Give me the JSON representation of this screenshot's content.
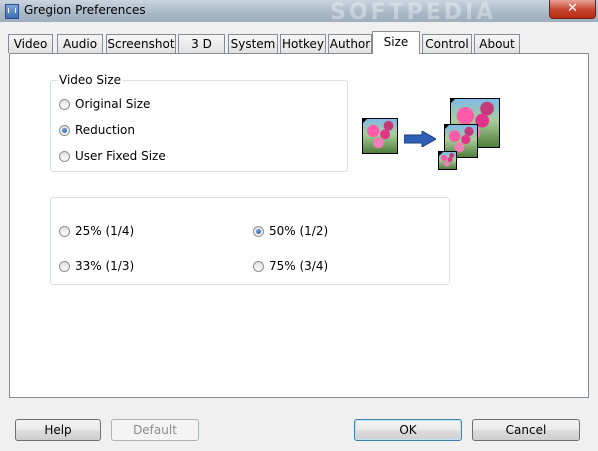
{
  "window": {
    "title": "Gregion Preferences",
    "watermark": "SOFTPEDIA",
    "close_glyph": "✕"
  },
  "tabs": [
    {
      "label": "Video"
    },
    {
      "label": "Audio"
    },
    {
      "label": "Screenshot"
    },
    {
      "label": "3 D"
    },
    {
      "label": "System"
    },
    {
      "label": "Hotkey"
    },
    {
      "label": "Author"
    },
    {
      "label": "Size",
      "active": true
    },
    {
      "label": "Control"
    },
    {
      "label": "About"
    }
  ],
  "video_size": {
    "legend": "Video Size",
    "options": [
      {
        "label": "Original Size",
        "selected": false
      },
      {
        "label": "Reduction",
        "selected": true
      },
      {
        "label": "User Fixed Size",
        "selected": false
      }
    ]
  },
  "reduction": {
    "options": [
      {
        "label": "25% (1/4)",
        "selected": false
      },
      {
        "label": "50% (1/2)",
        "selected": true
      },
      {
        "label": "33% (1/3)",
        "selected": false
      },
      {
        "label": "75% (3/4)",
        "selected": false
      }
    ]
  },
  "illustration": {
    "arrow_color": "#2f5fb7",
    "icons": [
      "flower-thumbnail-icon",
      "right-arrow-icon",
      "resized-thumbnails-icon"
    ]
  },
  "buttons": {
    "help": "Help",
    "default": "Default",
    "ok": "OK",
    "cancel": "Cancel"
  }
}
